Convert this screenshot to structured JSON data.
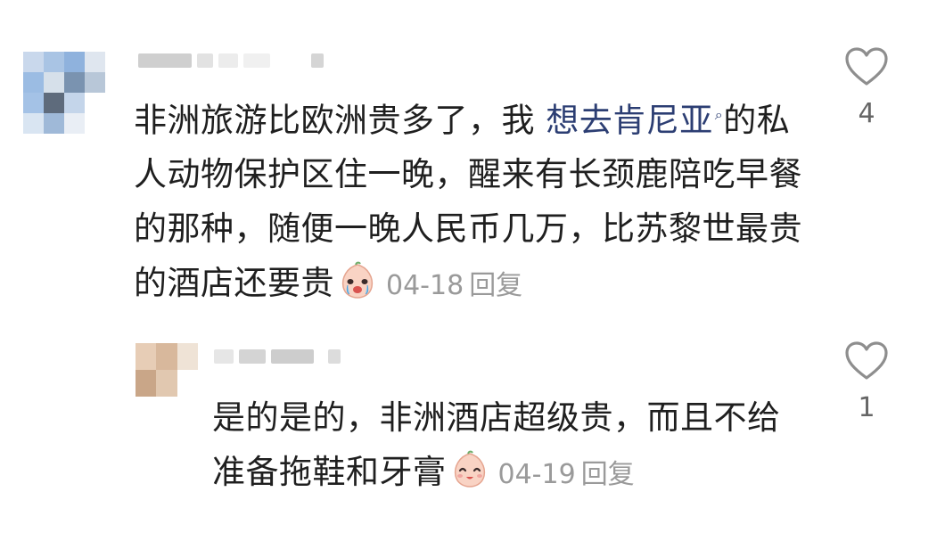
{
  "comments": [
    {
      "text_before": "非洲旅游比欧洲贵多了，我 ",
      "link_text": "想去肯尼亚",
      "text_after": "的私人动物保护区住一晚，醒来有长颈鹿陪吃早餐的那种，随便一晚人民币几万，比苏黎世最贵的酒店还要贵",
      "date": "04-18",
      "reply_label": "回复",
      "like_count": "4",
      "emoji_icon": "crying-face-emoji"
    },
    {
      "text": "是的是的，非洲酒店超级贵，而且不给准备拖鞋和牙膏",
      "date": "04-19",
      "reply_label": "回复",
      "like_count": "1",
      "emoji_icon": "smiling-face-emoji"
    }
  ],
  "colors": {
    "link": "#2c3e73",
    "meta": "#9a9a9a",
    "heart_outline": "#8e8e8e"
  }
}
